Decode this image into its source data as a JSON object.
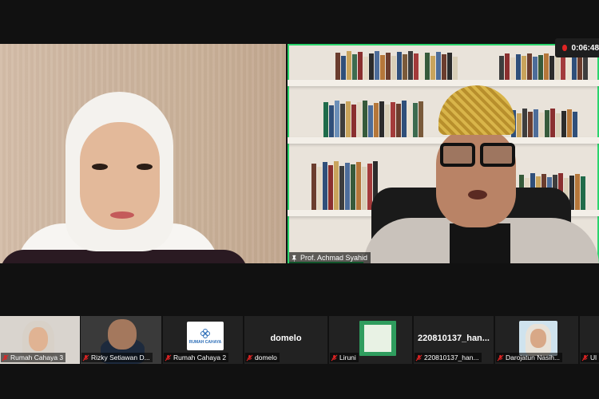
{
  "recording": {
    "time": "0:06:48"
  },
  "speaker": {
    "name": "Prof. Achmad Syahid"
  },
  "gallery": [
    {
      "name": "Rumah Cahaya 3",
      "type": "video"
    },
    {
      "name": "Rizky Setiawan D...",
      "type": "video"
    },
    {
      "name": "Rumah Cahaya 2",
      "type": "logo",
      "logo_text": "RUMAH CAHAYA"
    },
    {
      "name": "domelo",
      "type": "name",
      "title": "domelo"
    },
    {
      "name": "Liruni",
      "type": "book"
    },
    {
      "name": "220810137_han...",
      "type": "name",
      "title": "220810137_han..."
    },
    {
      "name": "Darojatun Nasih...",
      "type": "video"
    },
    {
      "name": "Ul",
      "type": "partial"
    }
  ],
  "colors": {
    "active_speaker_border": "#2bd46c",
    "muted_icon": "#e02424",
    "record_dot": "#e02424"
  },
  "icons": {
    "muted": "mic-muted-icon",
    "pin": "pin-icon",
    "recording": "record-dot-icon"
  }
}
